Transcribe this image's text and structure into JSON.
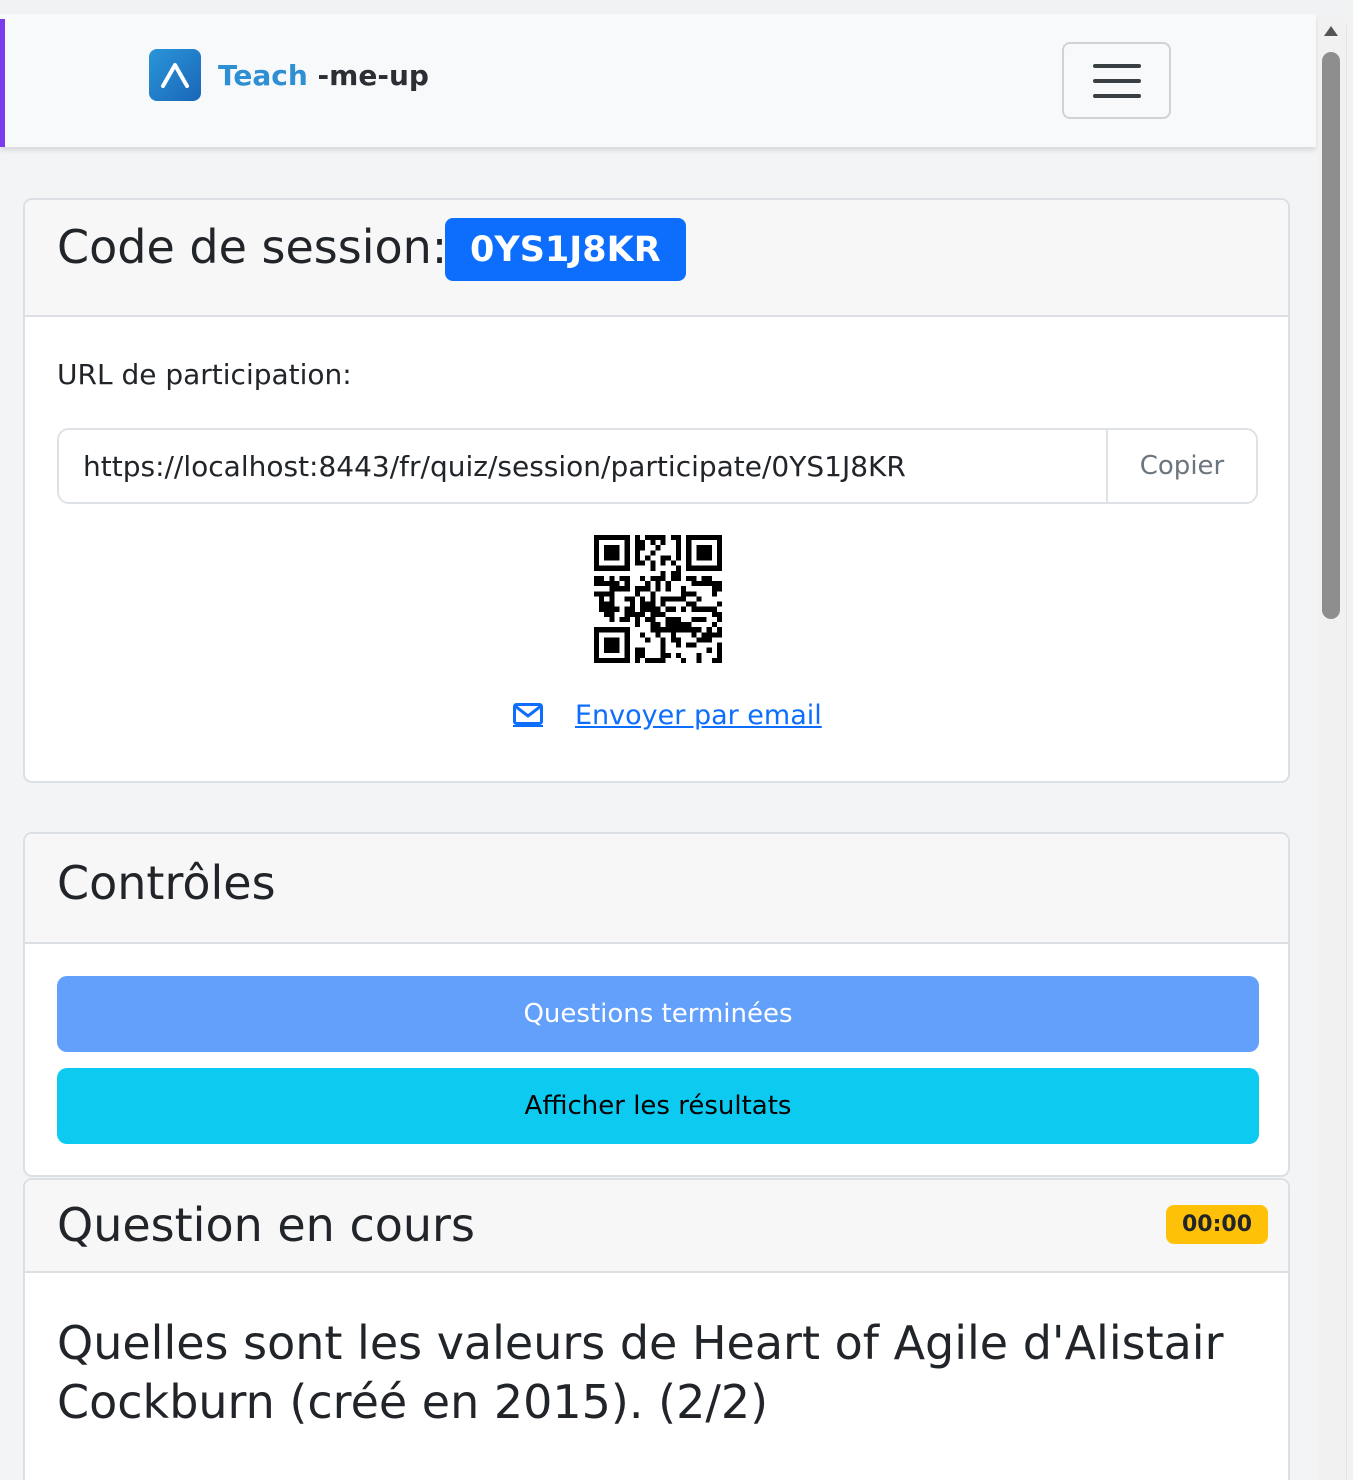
{
  "navbar": {
    "brand_teach": "Teach",
    "brand_rest": " -me-up",
    "logo_icon": "caret-up-logo-icon",
    "toggler_icon": "hamburger-menu-icon"
  },
  "session": {
    "title": "Code de session:",
    "code": "0YS1J8KR",
    "url_label": "URL de participation:",
    "url_value": "https://localhost:8443/fr/quiz/session/participate/0YS1J8KR",
    "copy_label": "Copier",
    "email_icon": "envelope-icon",
    "email_link": "Envoyer par email"
  },
  "controls": {
    "title": "Contrôles",
    "finished_label": "Questions terminées",
    "results_label": "Afficher les résultats"
  },
  "current_question": {
    "title": "Question en cours",
    "timer": "00:00",
    "text": "Quelles sont les valeurs de Heart of Agile d'Alistair Cockburn (créé en 2015). (2/2)"
  },
  "colors": {
    "primary": "#0d6efd",
    "info": "#0dcaf0",
    "warning": "#ffc107",
    "brand_blue": "#2f8fd3"
  }
}
